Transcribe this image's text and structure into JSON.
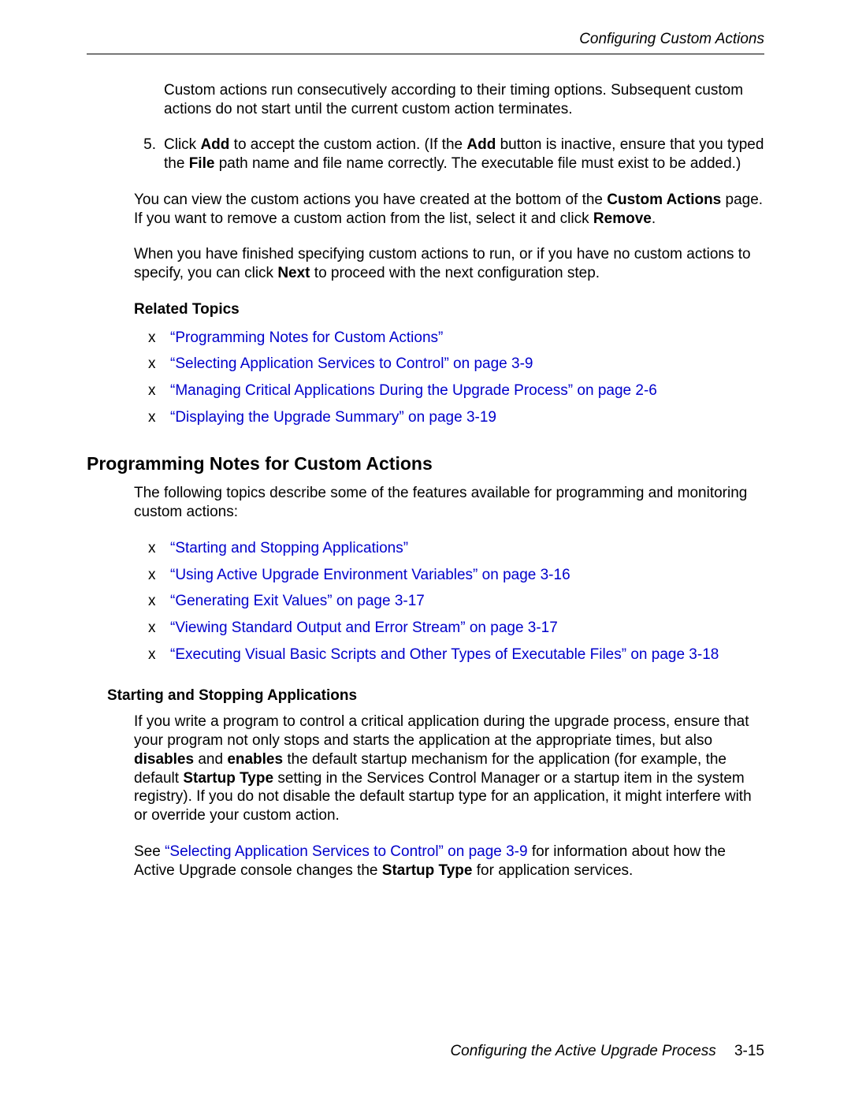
{
  "header": {
    "running_head": "Configuring Custom Actions"
  },
  "section_top": {
    "continuation_para": "Custom actions run consecutively according to their timing options. Subsequent custom actions do not start until the current custom action terminates.",
    "step5_num": "5.",
    "step5_pre": "Click ",
    "step5_b1": "Add",
    "step5_mid1": " to accept the custom action. (If the ",
    "step5_b2": "Add",
    "step5_mid2": " button is inactive, ensure that you typed the ",
    "step5_b3": "File",
    "step5_end": " path name and file name correctly. The executable file must exist to be added.)",
    "para_view_pre": "You can view the custom actions you have created at the bottom of the ",
    "para_view_b1": "Custom Actions",
    "para_view_mid": " page. If you want to remove a custom action from the list, select it and click ",
    "para_view_b2": "Remove",
    "para_view_end": ".",
    "para_next_pre": "When you have finished specifying custom actions to run, or if you have no custom actions to specify, you can click ",
    "para_next_b": "Next",
    "para_next_end": " to proceed with the next configuration step.",
    "related_label": "Related Topics",
    "links": {
      "l1": "“Programming Notes for Custom Actions”",
      "l2": "“Selecting Application Services to Control” on page 3-9",
      "l3": "“Managing Critical Applications During the Upgrade Process” on page 2-6",
      "l4": "“Displaying the Upgrade Summary” on page 3-19"
    }
  },
  "section_prog": {
    "title": "Programming Notes for Custom Actions",
    "intro": "The following topics describe some of the features available for programming and monitoring custom actions:",
    "links": {
      "l1": "“Starting and Stopping Applications”",
      "l2": "“Using Active Upgrade Environment Variables” on page 3-16",
      "l3": "“Generating Exit Values” on page 3-17",
      "l4": "“Viewing Standard Output and Error Stream” on page 3-17",
      "l5": "“Executing Visual Basic Scripts and Other Types of Executable Files” on page 3-18"
    }
  },
  "section_startstop": {
    "title": "Starting and Stopping Applications",
    "p1_pre": "If you write a program to control a critical application during the upgrade process, ensure that your program not only stops and starts the application at the appropriate times, but also ",
    "p1_b1": "disables",
    "p1_mid1": " and ",
    "p1_b2": "enables",
    "p1_mid2": " the default startup mechanism for the application (for example, the default ",
    "p1_b3": "Startup Type",
    "p1_end": " setting in the Services Control Manager or a startup item in the system registry). If you do not disable the default startup type for an application, it might interfere with or override your custom action.",
    "p2_pre": "See ",
    "p2_link": "“Selecting Application Services to Control” on page 3-9",
    "p2_mid": " for information about how the Active Upgrade console changes the ",
    "p2_b": "Startup Type",
    "p2_end": " for application services."
  },
  "footer": {
    "chapter": "Configuring the Active Upgrade Process",
    "page_num": "3-15"
  }
}
